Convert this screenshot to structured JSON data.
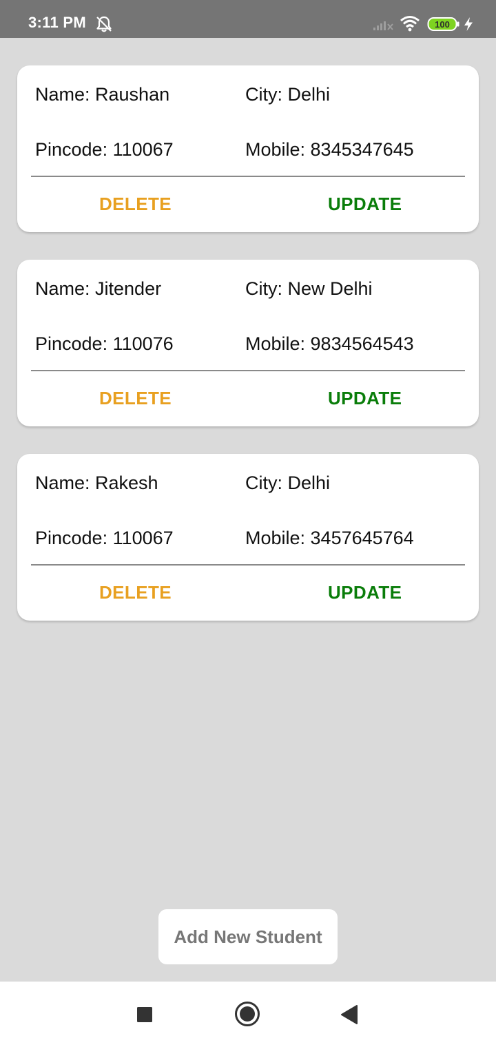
{
  "status_bar": {
    "time": "3:11 PM",
    "battery": "100",
    "icons": [
      "bell-off-icon",
      "signal-icon",
      "wifi-icon",
      "battery-icon",
      "charging-bolt-icon"
    ]
  },
  "students": [
    {
      "name": "Name: Raushan",
      "city": "City: Delhi",
      "pincode": "Pincode: 110067",
      "mobile": "Mobile: 8345347645",
      "delete_label": "DELETE",
      "update_label": "UPDATE"
    },
    {
      "name": "Name: Jitender",
      "city": "City: New Delhi",
      "pincode": "Pincode: 110076",
      "mobile": "Mobile: 9834564543",
      "delete_label": "DELETE",
      "update_label": "UPDATE"
    },
    {
      "name": "Name: Rakesh",
      "city": "City: Delhi",
      "pincode": "Pincode: 110067",
      "mobile": "Mobile: 3457645764",
      "delete_label": "DELETE",
      "update_label": "UPDATE"
    }
  ],
  "add_button": {
    "label": "Add New Student"
  },
  "colors": {
    "delete": "#e8a020",
    "update": "#0a7d0a",
    "background": "#dadada",
    "status_bar": "#757575",
    "battery": "#7ed321"
  },
  "nav_bar": {
    "icons": [
      "recents-square-icon",
      "home-circle-icon",
      "back-triangle-icon"
    ]
  }
}
